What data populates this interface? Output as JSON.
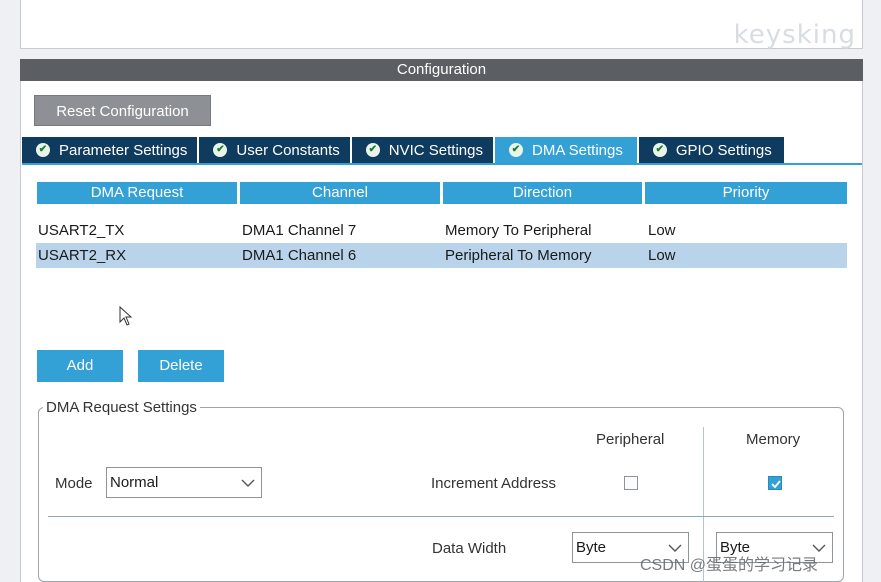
{
  "watermark": {
    "top": "keysking",
    "bottom": "CSDN @蛋蛋的学习记录"
  },
  "header": {
    "title": "Configuration"
  },
  "toolbar": {
    "reset_label": "Reset Configuration"
  },
  "tabs": [
    {
      "label": "Parameter Settings",
      "active": false
    },
    {
      "label": "User Constants",
      "active": false
    },
    {
      "label": "NVIC Settings",
      "active": false
    },
    {
      "label": "DMA Settings",
      "active": true
    },
    {
      "label": "GPIO Settings",
      "active": false
    }
  ],
  "dma_table": {
    "headers": [
      "DMA Request",
      "Channel",
      "Direction",
      "Priority"
    ],
    "rows": [
      [
        "USART2_TX",
        "DMA1 Channel 7",
        "Memory To Peripheral",
        "Low"
      ],
      [
        "USART2_RX",
        "DMA1 Channel 6",
        "Peripheral To Memory",
        "Low"
      ]
    ],
    "selected_row": 1
  },
  "actions": {
    "add_label": "Add",
    "delete_label": "Delete"
  },
  "request_settings": {
    "title": "DMA Request Settings",
    "peripheral_label": "Peripheral",
    "memory_label": "Memory",
    "mode_label": "Mode",
    "mode_value": "Normal",
    "increment_label": "Increment Address",
    "increment_peripheral": false,
    "increment_memory": true,
    "data_width_label": "Data Width",
    "data_width_peripheral": "Byte",
    "data_width_memory": "Byte"
  },
  "colors": {
    "accent": "#33a0d6",
    "tab_dark": "#0f3b5e",
    "selected_row": "#b9d3ea",
    "header_bar": "#5b5e62"
  }
}
